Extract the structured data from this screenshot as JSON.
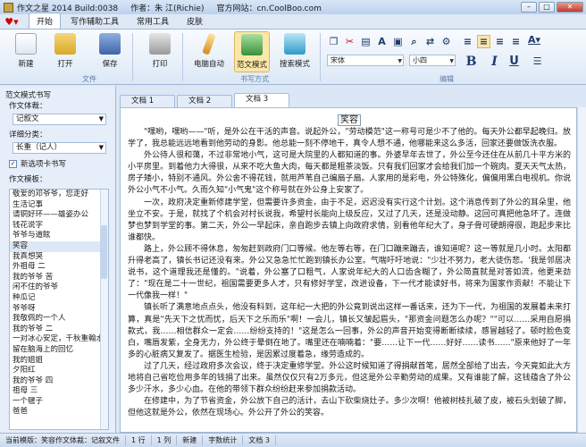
{
  "titlebar": {
    "app": "作文之星 2014 Build:0038",
    "author": "作者：朱 江(Richie)",
    "site": "官方网站：cn.CoolBoo.com"
  },
  "menu_tabs": [
    "开始",
    "写作辅助工具",
    "常用工具",
    "皮肤"
  ],
  "ribbon": {
    "buttons": {
      "new": "新建",
      "open": "打开",
      "save": "保存",
      "print": "打印",
      "auto_print": "电脑自动",
      "sample_mode": "范文模式",
      "search_mode": "搜索模式"
    },
    "groups": {
      "file": "文件",
      "writing": "书写方式",
      "edit": "编辑"
    },
    "font_name": "宋体",
    "font_size": "小四"
  },
  "left_panel": {
    "title": "范文模式书写",
    "type_label": "作文体裁：",
    "type_value": "记叙文",
    "category_label": "详细分类：",
    "category_value": "长重（记人）",
    "new_tab_label": "新选项卡书写",
    "template_label": "作文模板：",
    "templates": [
      "敬爱的邓爷爷，您走好",
      "生活记事",
      "请铜好环——雄姿办公",
      "钱花说字",
      "爷爷与道眩",
      "笑容",
      "我真想哭",
      "外祖母 二",
      "我的爷爷 苦",
      "闲不住的爷爷",
      "种瓜记",
      "爷爷呀",
      "我敬佩的一个人",
      "我的爷爷 二",
      "一对冰心安定，千秋重翰水",
      "留在脑海上的回忆",
      "我的姐姐",
      "夕阳红",
      "我的爷爷 四",
      "祖母 三",
      "一个毽子",
      "爸爸"
    ]
  },
  "doc_tabs": [
    "文档 1",
    "文档 2",
    "文档 3"
  ],
  "editor": {
    "title": "笑容",
    "paragraphs": [
      "\"嘿哟，嘿哟——\"听，是外公在干活的声音。说起外公，\"劳动模范\"这一称号可是少不了他的。每天外公都早起晚归。放学了，我总能远远地看到他劳动的身影。他总能一刻不停地干，真令人想不通，他哪能来这么多活，回家还要做饭洗衣服。",
      "外公待人很和蔼，不过非常地小气，这可是大院里的人都知道的事。外婆早年去世了，外公至今还住在从前几十平方米的小平房里。到着他力大得很，从来不吃大鱼大肉，每天都是粗茶淡饭。只有我们回家才会给我们加一个碗肉。夏天天气太热，房子矮小，特别不通风。外公舍不得花钱，就用芦苇自己编扇子扇。人家用的是彩电，外公特殊化，偏偏用黑白电视机。你说外公小气不小气。久而久知\"小气鬼\"这个称号就在外公身上安家了。",
      "一次，政府决定重新修建学堂，但需要许多资金，由于不足，迟迟没有实行这个计划。这个消息传到了外公的耳朵里，他坐立不安。于是，就找了个机会对村长说我，希望村长能向上级反应，又过了几天，还是没动静。这回可真把他急坏了。连做梦也梦到学堂的事。第二天，外公一早起床，亲自跑步去镇上向政府求情，别看他年纪大了，身子骨可硬朗得很，跑起步来比谁都快。",
      "路上，外公顾不得休息，匆匆赶到政府门口等候。他左等右等，在门口蹦来蹦去，谁知道呢？这一等就是几小时。太阳都升得老高了，镇长书记还没有来。外公又急急忙忙跑到镇长办公室。气喘吁吁地说：\"少壮不努力，老大徒伤悲。'我是邻居决说书，这个道理我还是懂的。\"说着，外公塞了口粗气，人家说年纪大的人口齿含糊了，外公简直就是对答如流，他更来劲了：\"现在是二十一世纪，祖国需要更多人才，只有修好学堂，改进设备，下一代才能读好书，将来为国家作贡献！不能让下一代像我一样！\"",
      "镇长听了满意地点点头，他没有料到，这年纪一大把的外公竟到说出这样一番话来，还为下一代，为祖国的发展着未来打算，真是\"先天下之忧而忧，后天下之乐而乐\"啊！一会儿，镇长又皱起眉头，\"那资金问题怎么办呢？\"\"可以……采用自愿捐款式，我……相信群众一定会……纷纷支持的！\"这是怎么一回事，外公的声音开始变得断断续续，感冒越轻了。顿时脸色变白，嘴唇发紫，全身无力，外公终于晕倒在地了。嘴里还在喃喃着：\"要……让下一代……好好……读书……\"原来他好了一年多的心脏病又复发了。据医生检验，是因累过度着急，缘劳造成的。",
      "过了几天，经过政府多次会议，终于决定重修学堂。外公这时候知道了得捐献首笔，居然全部给了出去，今天竟如此大方地将自己省吃俭用多年的钱捐了出来。虽然仅仅只有2万多元，但这是外公辛勤劳动的成果。又有谁能了解，这钱蕴含了外公多少汗水，多少心血。在他的带领下群众纷纷赶来参加捐款活动。",
      "在修建中，为了节省资金，外公放下自己的活计，去山下砍柴烧灶子。多少次啊！他被树枝扎破了皮，被石头划破了脚，但他这就是外公，依然在现场心。外公开了外公的笑容。"
    ]
  },
  "status": {
    "current": "当前模版：笑容作文体裁：记叙文件",
    "row": "1 行",
    "col": "1 列",
    "mode": "新建",
    "counter": "字数统计",
    "doc": "文档 3"
  },
  "colors": {
    "accent": "#1f3b6e",
    "ribbon_bg": "#dce8f6"
  }
}
